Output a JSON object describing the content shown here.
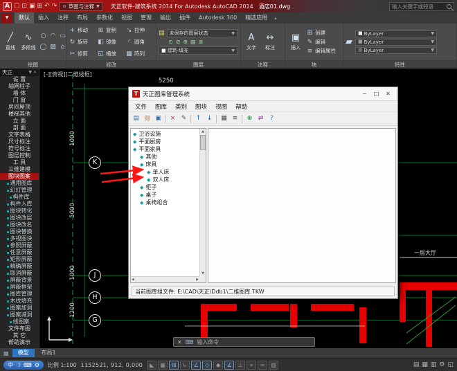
{
  "colors": {
    "titlebar_red": "#a81414",
    "sidebar_highlight_red": "#a81010",
    "axis_green": "#00a832",
    "wall_red": "#e60000",
    "arrow_red": "#ff1616",
    "active_tab_blue": "#2a76c4"
  },
  "title_bar": {
    "logo": "A",
    "qat": [
      {
        "name": "new-file-icon",
        "glyph": "□"
      },
      {
        "name": "open-file-icon",
        "glyph": "⊡"
      },
      {
        "name": "save-file-icon",
        "glyph": "▣"
      },
      {
        "name": "plot-icon",
        "glyph": "⊞"
      },
      {
        "name": "undo-icon",
        "glyph": "↶"
      },
      {
        "name": "redo-icon",
        "glyph": "↷"
      }
    ],
    "workspace_label": "草图与注释",
    "title": "天正软件-建筑系统 2014 For Autodesk AutoCAD 2014",
    "filename": "酒店01.dwg",
    "search_placeholder": "输入关键字或短语"
  },
  "ribbon": {
    "tabs": [
      {
        "label": "默认",
        "active": true
      },
      {
        "label": "插入"
      },
      {
        "label": "注释"
      },
      {
        "label": "布局"
      },
      {
        "label": "参数化"
      },
      {
        "label": "视图"
      },
      {
        "label": "管理"
      },
      {
        "label": "输出"
      },
      {
        "label": "插件"
      },
      {
        "label": "Autodesk 360"
      },
      {
        "label": "精选应用"
      }
    ],
    "draw": {
      "label": "绘图",
      "big": [
        {
          "name": "line-button",
          "label": "直线",
          "glyph": "╱"
        },
        {
          "name": "polyline-button",
          "label": "多段线",
          "glyph": "∿"
        }
      ],
      "small": [
        {
          "name": "circle-icon",
          "glyph": "○"
        },
        {
          "name": "arc-icon",
          "glyph": "◠"
        },
        {
          "name": "rectangle-icon",
          "glyph": "▭"
        },
        {
          "name": "ellipse-icon",
          "glyph": "◯"
        },
        {
          "name": "hatch-icon",
          "glyph": "▨"
        },
        {
          "name": "polygon-icon",
          "glyph": "⌂"
        }
      ]
    },
    "modify": {
      "label": "修改",
      "buttons": [
        {
          "name": "move-button",
          "label": "移动",
          "glyph": "+"
        },
        {
          "name": "copy-button",
          "label": "复制",
          "glyph": "⊞"
        },
        {
          "name": "stretch-button",
          "label": "拉伸",
          "glyph": "↘"
        },
        {
          "name": "rotate-button",
          "label": "旋转",
          "glyph": "↻"
        },
        {
          "name": "mirror-button",
          "label": "镜像",
          "glyph": "◧"
        },
        {
          "name": "fillet-button",
          "label": "圆角",
          "glyph": "◜"
        },
        {
          "name": "trim-button",
          "label": "修剪",
          "glyph": "✂"
        },
        {
          "name": "scale-button",
          "label": "缩放",
          "glyph": "◱"
        },
        {
          "name": "array-button",
          "label": "阵列",
          "glyph": "▦"
        }
      ]
    },
    "layer": {
      "label": "图层",
      "properties_icon_glyph": "▤",
      "state_dropd own_note": "",
      "state_dropdown": "未保存的图层状态",
      "mini_icons": [
        {
          "name": "layer-on-icon",
          "glyph": "⊙"
        },
        {
          "name": "layer-freeze-icon",
          "glyph": "⊘"
        },
        {
          "name": "layer-lock-icon",
          "glyph": "⊕"
        },
        {
          "name": "layer-isolate-icon",
          "glyph": "▧"
        },
        {
          "name": "layer-match-icon",
          "glyph": "≣"
        }
      ],
      "layer_dropdown": "建筑-填充"
    },
    "annotate": {
      "label": "注释",
      "buttons": [
        {
          "name": "text-button",
          "label": "文字",
          "glyph": "A"
        },
        {
          "name": "dimension-button",
          "label": "标注",
          "glyph": "↔"
        }
      ]
    },
    "block": {
      "label": "块",
      "big": {
        "label": "插入",
        "glyph": "▣"
      },
      "small": [
        {
          "name": "create-block-button",
          "label": "创建",
          "glyph": "⊞"
        },
        {
          "name": "edit-block-button",
          "label": "编辑",
          "glyph": "✎"
        },
        {
          "name": "edit-attribute-button",
          "label": "编辑属性",
          "glyph": "≡"
        }
      ]
    },
    "properties": {
      "label": "特性",
      "match_icon_glyph": "▰",
      "rows": [
        {
          "name": "object-color-control",
          "chip": "#e8e8e8",
          "value": "ByLayer"
        },
        {
          "name": "linetype-control",
          "chip": "#9a9a9a",
          "value": "ByLayer"
        },
        {
          "name": "lineweight-control",
          "chip": "#6a6a6a",
          "value": "ByLayer"
        }
      ]
    }
  },
  "sidebar": {
    "header": "天正",
    "items": [
      {
        "label": "设 置"
      },
      {
        "label": "轴网柱子"
      },
      {
        "label": "墙 体"
      },
      {
        "label": "门 窗"
      },
      {
        "label": "房间屋顶"
      },
      {
        "label": "楼梯其他"
      },
      {
        "label": "立 面"
      },
      {
        "label": "剖 面"
      },
      {
        "label": "文字表格"
      },
      {
        "label": "尺寸标注"
      },
      {
        "label": "符号标注"
      },
      {
        "label": "图层控制"
      },
      {
        "label": "工 具"
      },
      {
        "label": "三维建模"
      },
      {
        "label": "图块图案",
        "active": true
      },
      {
        "label": "通用图库",
        "type": "sub"
      },
      {
        "label": "幻灯管理",
        "type": "sub"
      },
      {
        "label": "构件库",
        "type": "sub"
      },
      {
        "label": "构件入库",
        "type": "sub"
      },
      {
        "label": "图块转化",
        "type": "sub"
      },
      {
        "label": "图块改层",
        "type": "sub"
      },
      {
        "label": "图块改名",
        "type": "sub"
      },
      {
        "label": "图块替换",
        "type": "sub"
      },
      {
        "label": "多视图块",
        "type": "sub"
      },
      {
        "label": "参照屏蔽",
        "type": "sub"
      },
      {
        "label": "任意屏蔽",
        "type": "sub"
      },
      {
        "label": "矩形屏蔽",
        "type": "sub"
      },
      {
        "label": "精确屏蔽",
        "type": "sub"
      },
      {
        "label": "取消屏蔽",
        "type": "sub"
      },
      {
        "label": "屏蔽背景",
        "type": "sub"
      },
      {
        "label": "屏蔽框架",
        "type": "sub"
      },
      {
        "label": "图库管理",
        "type": "sub"
      },
      {
        "label": "木纹填充",
        "type": "sub"
      },
      {
        "label": "图案加洞",
        "type": "sub"
      },
      {
        "label": "图案减洞",
        "type": "sub"
      },
      {
        "label": "线图案",
        "type": "sub"
      },
      {
        "label": "文件布图"
      },
      {
        "label": "其 它"
      },
      {
        "label": "帮助演示"
      }
    ]
  },
  "drawing": {
    "viewport_controls": "[-][俯视][二维线框]",
    "bubbles": [
      "K",
      "J",
      "H",
      "G"
    ],
    "dim_top": "5250",
    "dims_left": [
      "1000",
      "5000",
      "1000",
      "1200"
    ],
    "room_label": "一层大厅"
  },
  "dialog": {
    "title": "天正图库管理系统",
    "icon_letter": "T",
    "window_buttons": {
      "minimize": "─",
      "maximize": "□",
      "close": "✕"
    },
    "menus": [
      "文件",
      "图库",
      "类别",
      "图块",
      "视图",
      "帮助"
    ],
    "toolbar_icons": [
      {
        "name": "new-library-icon",
        "glyph": "▤",
        "color": "#2f6db3"
      },
      {
        "name": "open-library-icon",
        "glyph": "▧",
        "color": "#c9921e"
      },
      {
        "name": "save-library-icon",
        "glyph": "▣",
        "color": "#2f6db3"
      },
      {
        "type": "sep"
      },
      {
        "name": "delete-icon",
        "glyph": "×",
        "color": "#d42020"
      },
      {
        "name": "rename-icon",
        "glyph": "✎",
        "color": "#555555"
      },
      {
        "type": "sep"
      },
      {
        "name": "move-up-icon",
        "glyph": "↑",
        "color": "#1f5fbf"
      },
      {
        "name": "move-down-icon",
        "glyph": "↓",
        "color": "#1f5fbf"
      },
      {
        "type": "sep"
      },
      {
        "name": "thumbnail-view-icon",
        "glyph": "▦",
        "color": "#444444"
      },
      {
        "name": "list-view-icon",
        "glyph": "≡",
        "color": "#444444"
      },
      {
        "type": "sep"
      },
      {
        "name": "insert-block-icon",
        "glyph": "⊕",
        "color": "#1f7f3f"
      },
      {
        "name": "replace-block-icon",
        "glyph": "⇄",
        "color": "#8a2fa0"
      },
      {
        "name": "help-icon",
        "glyph": "?",
        "color": "#2f6db3"
      }
    ],
    "tree": [
      {
        "label": "卫浴设施",
        "level": 0
      },
      {
        "label": "平面厨房",
        "level": 0
      },
      {
        "label": "平面家具",
        "level": 0
      },
      {
        "label": "其他",
        "level": 1
      },
      {
        "label": "床具",
        "level": 1
      },
      {
        "label": "单人床",
        "level": 2
      },
      {
        "label": "双人床",
        "level": 2
      },
      {
        "label": "柜子",
        "level": 1
      },
      {
        "label": "桌子",
        "level": 1
      },
      {
        "label": "桌椅组合",
        "level": 1
      }
    ],
    "status": "当前图库组文件: E:\\CAD\\天正\\Ddb1\\二维图库.TKW"
  },
  "command_bar": {
    "close_glyph": "✕",
    "customize_glyph": "⌨",
    "placeholder": "输入命令"
  },
  "layout_tabs": {
    "grid_icon_glyph": "▦",
    "items": [
      {
        "label": "模型",
        "active": true
      },
      {
        "label": "布局1"
      }
    ]
  },
  "status_bar": {
    "ime_icons": [
      {
        "name": "ime-lang-icon",
        "glyph": "中"
      },
      {
        "name": "ime-moon-icon",
        "glyph": "☽"
      },
      {
        "name": "ime-keyboard-icon",
        "glyph": "⌨"
      },
      {
        "name": "ime-settings-icon",
        "glyph": "⚙"
      }
    ],
    "scale": "比例 1:100",
    "coords": "1152521, 912, 0,000",
    "toggles": [
      {
        "name": "infer-constraints-icon",
        "glyph": "◣",
        "active": false
      },
      {
        "name": "snap-icon",
        "glyph": "▦",
        "active": false
      },
      {
        "name": "grid-icon",
        "glyph": "⊞",
        "active": true
      },
      {
        "name": "ortho-icon",
        "glyph": "∟",
        "active": false
      },
      {
        "name": "polar-icon",
        "glyph": "∠",
        "active": true
      },
      {
        "name": "osnap-icon",
        "glyph": "◇",
        "active": true
      },
      {
        "name": "osnap-3d-icon",
        "glyph": "◆",
        "active": false
      },
      {
        "name": "otrack-icon",
        "glyph": "∡",
        "active": true
      },
      {
        "name": "ducs-icon",
        "glyph": "⊥",
        "active": false
      },
      {
        "name": "dyn-icon",
        "glyph": "⌖",
        "active": false
      },
      {
        "name": "lineweight-icon",
        "glyph": "━",
        "active": false
      },
      {
        "name": "transparency-icon",
        "glyph": "▨",
        "active": false
      }
    ],
    "right_icons": [
      {
        "name": "model-space-icon",
        "glyph": "▤"
      },
      {
        "name": "quick-view-layouts-icon",
        "glyph": "▦"
      },
      {
        "name": "quick-view-drawings-icon",
        "glyph": "▥"
      },
      {
        "name": "workspace-switch-icon",
        "glyph": "⚙"
      },
      {
        "name": "clean-screen-icon",
        "glyph": "◱"
      }
    ]
  }
}
